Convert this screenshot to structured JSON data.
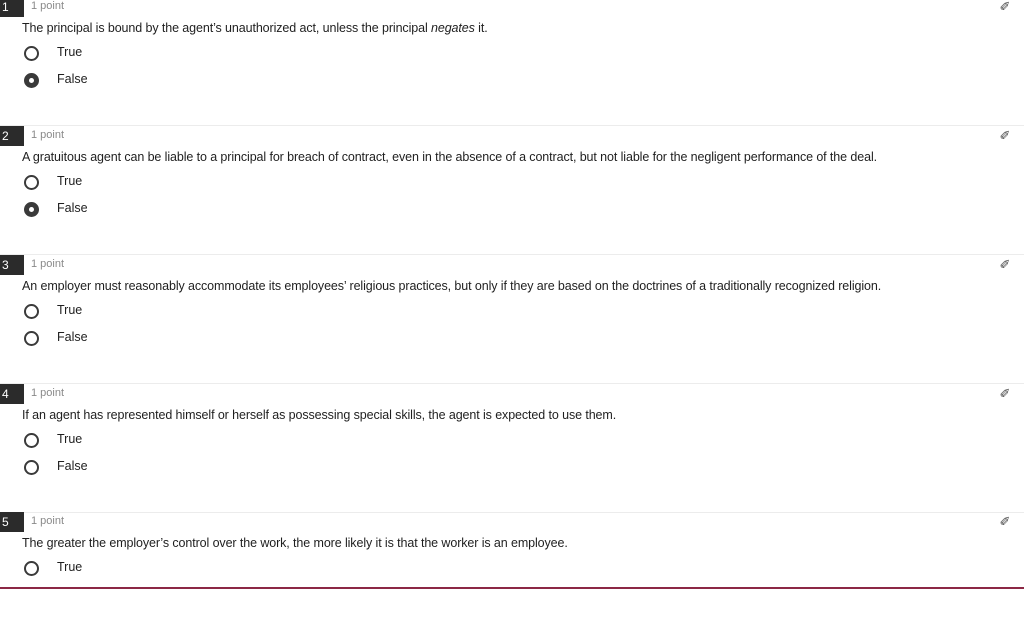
{
  "questions": [
    {
      "number": "1",
      "points": "1 point",
      "text_parts": [
        "The principal is bound by the agent’s unauthorized act, unless the principal ",
        "negates",
        " it."
      ],
      "options": [
        {
          "label": "True",
          "selected": false
        },
        {
          "label": "False",
          "selected": true
        }
      ]
    },
    {
      "number": "2",
      "points": "1 point",
      "text": "A gratuitous agent can be liable to a principal for breach of contract, even in the absence of a contract, but not liable for the negligent performance of the deal.",
      "options": [
        {
          "label": "True",
          "selected": false
        },
        {
          "label": "False",
          "selected": true
        }
      ]
    },
    {
      "number": "3",
      "points": "1 point",
      "text": "An employer must reasonably accommodate its employees’ religious practices, but only if they are based on the doctrines of a traditionally recognized religion.",
      "options": [
        {
          "label": "True",
          "selected": false
        },
        {
          "label": "False",
          "selected": false
        }
      ]
    },
    {
      "number": "4",
      "points": "1 point",
      "text": "If an agent has represented himself or herself as possessing special skills, the agent is expected to use them.",
      "options": [
        {
          "label": "True",
          "selected": false
        },
        {
          "label": "False",
          "selected": false
        }
      ]
    },
    {
      "number": "5",
      "points": "1 point",
      "text": "The greater the employer’s control over the work, the more likely it is that the worker is an employee.",
      "options": [
        {
          "label": "True",
          "selected": false
        }
      ]
    }
  ],
  "colors": {
    "accent_bar": "#8c2845",
    "radio": "#3a3a3a",
    "number_badge": "#2b2b2b"
  },
  "icons": {
    "pin": "pin-icon"
  }
}
